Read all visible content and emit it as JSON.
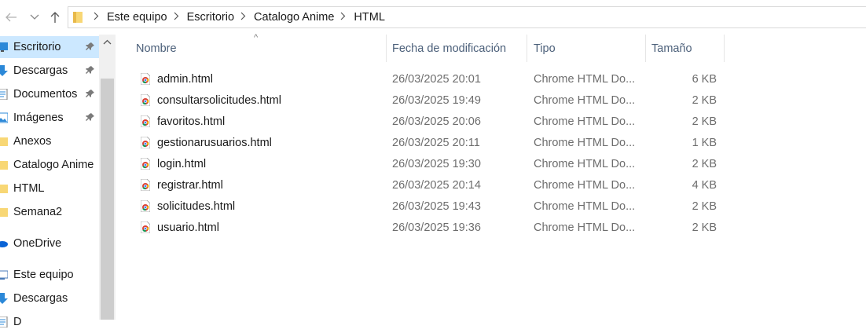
{
  "navigation": {
    "back_icon": "arrow-left-icon",
    "forward_icon": "chevron-down-icon",
    "up_icon": "arrow-up-icon"
  },
  "breadcrumb": [
    "Este equipo",
    "Escritorio",
    "Catalogo Anime",
    "HTML"
  ],
  "sidebar": {
    "items": [
      {
        "label": "Escritorio",
        "icon": "desktop-icon",
        "pinned": true,
        "selected": true
      },
      {
        "label": "Descargas",
        "icon": "download-arrow-icon",
        "pinned": true,
        "selected": false
      },
      {
        "label": "Documentos",
        "icon": "document-icon",
        "pinned": true,
        "selected": false
      },
      {
        "label": "Imágenes",
        "icon": "image-icon",
        "pinned": true,
        "selected": false
      },
      {
        "label": "Anexos",
        "icon": "folder-icon",
        "pinned": false,
        "selected": false
      },
      {
        "label": "Catalogo Anime",
        "icon": "folder-icon",
        "pinned": false,
        "selected": false
      },
      {
        "label": "HTML",
        "icon": "folder-icon",
        "pinned": false,
        "selected": false
      },
      {
        "label": "Semana2",
        "icon": "folder-icon",
        "pinned": false,
        "selected": false
      },
      {
        "label": "OneDrive",
        "icon": "cloud-icon",
        "pinned": false,
        "selected": false
      },
      {
        "label": "Este equipo",
        "icon": "computer-icon",
        "pinned": false,
        "selected": false
      },
      {
        "label": "Descargas",
        "icon": "download-arrow-icon",
        "pinned": false,
        "selected": false
      },
      {
        "label": "D",
        "icon": "document-icon",
        "pinned": false,
        "selected": false
      }
    ]
  },
  "columns": {
    "name": "Nombre",
    "date": "Fecha de modificación",
    "type": "Tipo",
    "size": "Tamaño"
  },
  "files": [
    {
      "name": "admin.html",
      "date": "26/03/2025 20:01",
      "type": "Chrome HTML Do...",
      "size": "6 KB"
    },
    {
      "name": "consultarsolicitudes.html",
      "date": "26/03/2025 19:49",
      "type": "Chrome HTML Do...",
      "size": "2 KB"
    },
    {
      "name": "favoritos.html",
      "date": "26/03/2025 20:06",
      "type": "Chrome HTML Do...",
      "size": "2 KB"
    },
    {
      "name": "gestionarusuarios.html",
      "date": "26/03/2025 20:11",
      "type": "Chrome HTML Do...",
      "size": "1 KB"
    },
    {
      "name": "login.html",
      "date": "26/03/2025 19:30",
      "type": "Chrome HTML Do...",
      "size": "2 KB"
    },
    {
      "name": "registrar.html",
      "date": "26/03/2025 20:14",
      "type": "Chrome HTML Do...",
      "size": "4 KB"
    },
    {
      "name": "solicitudes.html",
      "date": "26/03/2025 19:43",
      "type": "Chrome HTML Do...",
      "size": "2 KB"
    },
    {
      "name": "usuario.html",
      "date": "26/03/2025 19:36",
      "type": "Chrome HTML Do...",
      "size": "2 KB"
    }
  ],
  "colors": {
    "selected_bg": "#cce8ff",
    "header_text": "#4c607a",
    "folder": "#f8d775",
    "chrome_red": "#db4437",
    "chrome_green": "#0f9d58",
    "chrome_yellow": "#f4b400",
    "chrome_blue": "#4285f4"
  }
}
